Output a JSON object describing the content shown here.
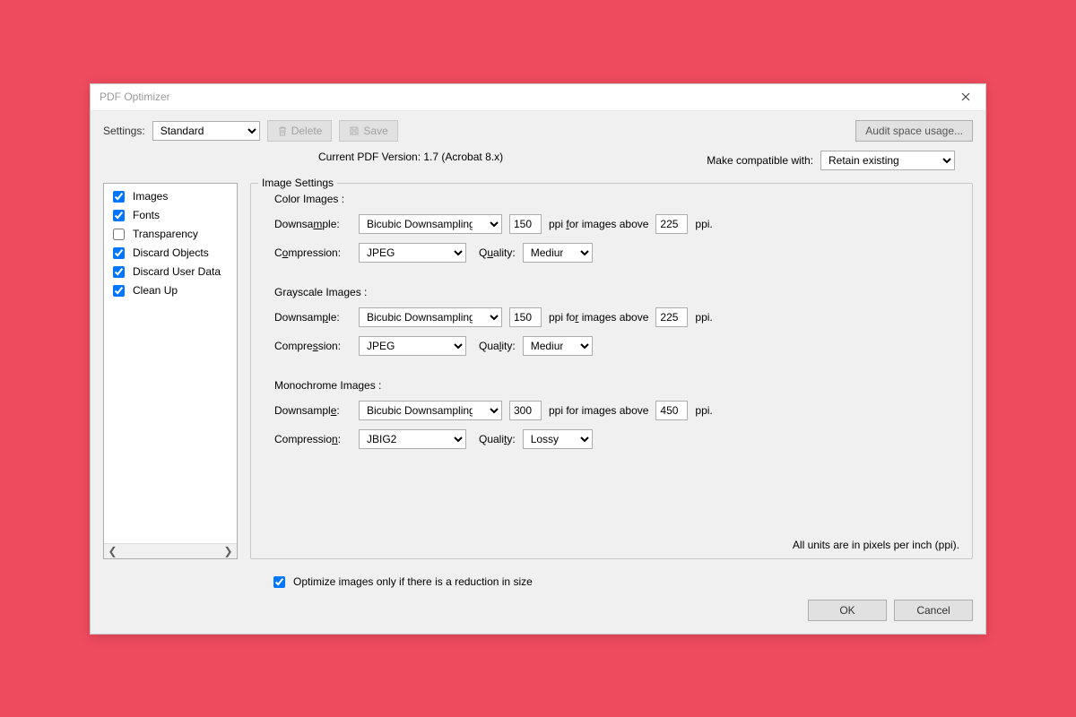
{
  "title": "PDF Optimizer",
  "toolbar": {
    "settings_label": "Settings:",
    "settings_value": "Standard",
    "delete_label": "Delete",
    "save_label": "Save",
    "audit_label": "Audit space usage..."
  },
  "version": {
    "current_label": "Current PDF Version: 1.7 (Acrobat 8.x)",
    "compat_label": "Make compatible with:",
    "compat_value": "Retain existing"
  },
  "categories": [
    {
      "label": "Images",
      "checked": true
    },
    {
      "label": "Fonts",
      "checked": true
    },
    {
      "label": "Transparency",
      "checked": false
    },
    {
      "label": "Discard Objects",
      "checked": true
    },
    {
      "label": "Discard User Data",
      "checked": true
    },
    {
      "label": "Clean Up",
      "checked": true
    }
  ],
  "panel": {
    "title": "Image Settings",
    "downsample_label": "Downsample:",
    "compression_label": "Compression:",
    "quality_label": "Quality:",
    "ppi_mid": "ppi for images above",
    "ppi_suffix": "ppi.",
    "units_note": "All units are in pixels per inch (ppi).",
    "color": {
      "title": "Color Images :",
      "downsample": "Bicubic Downsampling to",
      "ppi": "150",
      "above": "225",
      "compression": "JPEG",
      "quality": "Medium"
    },
    "gray": {
      "title": "Grayscale Images :",
      "downsample": "Bicubic Downsampling to",
      "ppi": "150",
      "above": "225",
      "compression": "JPEG",
      "quality": "Medium"
    },
    "mono": {
      "title": "Monochrome Images :",
      "downsample": "Bicubic Downsampling to",
      "ppi": "300",
      "above": "450",
      "compression": "JBIG2",
      "quality": "Lossy"
    }
  },
  "footer": {
    "optimize_label": "Optimize images only if there is a reduction in size",
    "ok": "OK",
    "cancel": "Cancel"
  }
}
